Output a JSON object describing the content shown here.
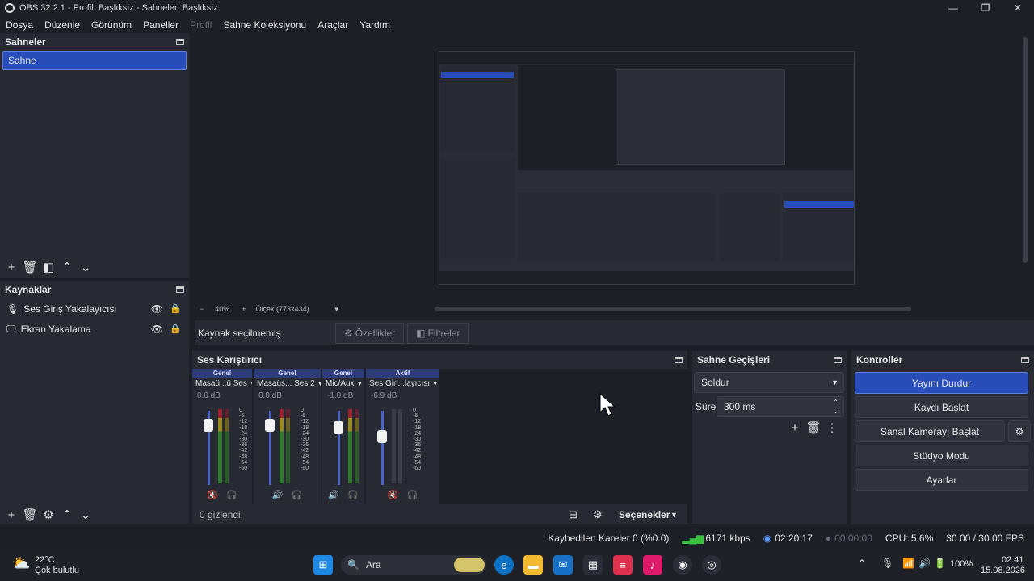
{
  "window": {
    "title": "OBS 32.2.1 - Profil: Başlıksız - Sahneler: Başlıksız",
    "minimize": "—",
    "maximize": "❐",
    "close": "✕"
  },
  "menu": [
    "Dosya",
    "Düzenle",
    "Görünüm",
    "Paneller",
    "Profil",
    "Sahne Koleksiyonu",
    "Araçlar",
    "Yardım"
  ],
  "scenes": {
    "title": "Sahneler",
    "items": [
      "Sahne"
    ]
  },
  "sources": {
    "title": "Kaynaklar",
    "items": [
      {
        "label": "Ses Giriş Yakalayıcısı",
        "icon": "microphone-icon"
      },
      {
        "label": "Ekran Yakalama",
        "icon": "monitor-icon"
      }
    ]
  },
  "preview": {
    "zoom_minus": "−",
    "zoom_level": "40%",
    "zoom_plus": "+",
    "scale_label": "Ölçek (773x434)"
  },
  "context": {
    "no_source": "Kaynak seçilmemiş",
    "properties": "Özellikler",
    "filters": "Filtreler"
  },
  "mixer": {
    "title": "Ses Karıştırıcı",
    "channels": [
      {
        "tag": "Genel",
        "name": "Masaü...ü Ses",
        "db": "0.0 dB",
        "level": 0.85,
        "muted": true
      },
      {
        "tag": "Genel",
        "name": "Masaüs... Ses 2",
        "db": "0.0 dB",
        "level": 0.85,
        "muted": false
      },
      {
        "tag": "Genel",
        "name": "Mic/Aux",
        "db": "-1.0 dB",
        "level": 0.82,
        "muted": false
      },
      {
        "tag": "Aktif",
        "name": "Ses Giri...layıcısı",
        "db": "-6.9 dB",
        "level": 0.7,
        "muted": true
      }
    ],
    "ticks": [
      "0",
      "-6",
      "-12",
      "-18",
      "-24",
      "-30",
      "-36",
      "-42",
      "-48",
      "-54",
      "-60"
    ],
    "hidden_count": "0 gizlendi",
    "options": "Seçenekler"
  },
  "transitions": {
    "title": "Sahne Geçişleri",
    "type": "Soldur",
    "duration_label": "Süre",
    "duration_value": "300 ms"
  },
  "controls": {
    "title": "Kontroller",
    "stop_stream": "Yayını Durdur",
    "start_record": "Kaydı Başlat",
    "start_virtualcam": "Sanal Kamerayı Başlat",
    "studio_mode": "Stüdyo Modu",
    "settings": "Ayarlar"
  },
  "status": {
    "dropped_frames": "Kaybedilen Kareler 0 (%0.0)",
    "bitrate": "6171 kbps",
    "stream_time": "02:20:17",
    "record_time": "00:00:00",
    "cpu": "CPU: 5.6%",
    "fps": "30.00 / 30.00 FPS"
  },
  "taskbar": {
    "weather_temp": "22°C",
    "weather_desc": "Çok bulutlu",
    "search": "Ara",
    "battery": "100%",
    "time": "02:41",
    "date": "15.08.2026"
  },
  "colors": {
    "accent": "#284cb8",
    "panel": "#272a33",
    "background": "#1d1f26"
  }
}
